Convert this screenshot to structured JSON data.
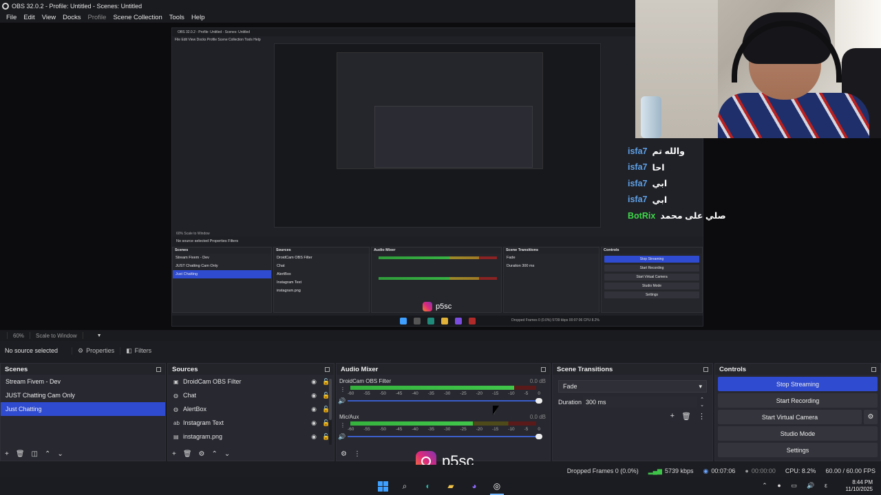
{
  "window": {
    "title": "OBS 32.0.2 - Profile: Untitled - Scenes: Untitled"
  },
  "menu": [
    "File",
    "Edit",
    "View",
    "Docks",
    "Profile",
    "Scene Collection",
    "Tools",
    "Help"
  ],
  "menu_disabled": "Profile",
  "nested_capture": {
    "title": "OBS 32.0.2 - Profile: Untitled - Scenes: Untitled",
    "menu": "File  Edit  View  Docks  Profile  Scene Collection  Tools  Help",
    "zoom": "60%   Scale to Window",
    "source": "No source selected        Properties     Filters",
    "scenes_header": "Scenes",
    "sources_header": "Sources",
    "mixer_header": "Audio Mixer",
    "transitions_header": "Scene Transitions",
    "controls_header": "Controls",
    "scenes": [
      "Stream Fivem - Dev",
      "JUST Chatting Cam Only",
      "Just Chatting"
    ],
    "sources": [
      "DroidCam OBS Filter",
      "Chat",
      "AlertBox",
      "Instagram Text",
      "instagram.png"
    ],
    "controls": [
      "Stop Streaming",
      "Start Recording",
      "Start Virtual Camera",
      "Studio Mode",
      "Settings"
    ],
    "transition": "Fade",
    "duration": "Duration   300 ms",
    "instagram": "p5sc",
    "status": "Dropped Frames 0 (0.0%)   5739 kbps   00:07:06   CPU 8.2%"
  },
  "chat": [
    {
      "user": "isfa7",
      "text": "والله تم",
      "bot": false
    },
    {
      "user": "isfa7",
      "text": "احا",
      "bot": false
    },
    {
      "user": "isfa7",
      "text": "ابي",
      "bot": false
    },
    {
      "user": "isfa7",
      "text": "ابي",
      "bot": false
    },
    {
      "user": "BotRix",
      "text": "صلي على محمد",
      "bot": true
    }
  ],
  "zoom": {
    "level": "60%",
    "scale": "Scale to Window"
  },
  "source_bar": {
    "selected": "No source selected",
    "properties": "Properties",
    "filters": "Filters"
  },
  "scenes": {
    "header": "Scenes",
    "items": [
      "Stream Fivem - Dev",
      "JUST Chatting Cam Only",
      "Just Chatting"
    ],
    "selected": "Just Chatting"
  },
  "sources": {
    "header": "Sources",
    "items": [
      {
        "name": "DroidCam OBS Filter",
        "icon": "camera-icon"
      },
      {
        "name": "Chat",
        "icon": "browser-icon"
      },
      {
        "name": "AlertBox",
        "icon": "browser-icon"
      },
      {
        "name": "Instagram Text",
        "icon": "text-icon"
      },
      {
        "name": "instagram.png",
        "icon": "image-icon"
      }
    ]
  },
  "mixer": {
    "header": "Audio Mixer",
    "channels": [
      {
        "name": "DroidCam OBS Filter",
        "db": "0.0 dB",
        "level": 0.88
      },
      {
        "name": "Mic/Aux",
        "db": "0.0 dB",
        "level": 0.66
      }
    ],
    "ticks": [
      "-60",
      "-55",
      "-50",
      "-45",
      "-40",
      "-35",
      "-30",
      "-25",
      "-20",
      "-15",
      "-10",
      "-5",
      "0"
    ]
  },
  "transitions": {
    "header": "Scene Transitions",
    "selected": "Fade",
    "duration_label": "Duration",
    "duration_value": "300 ms"
  },
  "controls": {
    "header": "Controls",
    "stop_streaming": "Stop Streaming",
    "start_recording": "Start Recording",
    "start_virtual_camera": "Start Virtual Camera",
    "studio_mode": "Studio Mode",
    "settings": "Settings"
  },
  "overlay": {
    "instagram": "p5sc"
  },
  "status": {
    "dropped": "Dropped Frames 0 (0.0%)",
    "bitrate": "5739 kbps",
    "stream_time": "00:07:06",
    "rec_time": "00:00:00",
    "cpu": "CPU: 8.2%",
    "fps": "60.00 / 60.00 FPS"
  },
  "taskbar": {
    "time": "8:44 PM",
    "date": "11/10/2025"
  },
  "colors": {
    "accent": "#2f4bd0",
    "chat_user": "#5fa2e8",
    "bot": "#3fd74a"
  }
}
